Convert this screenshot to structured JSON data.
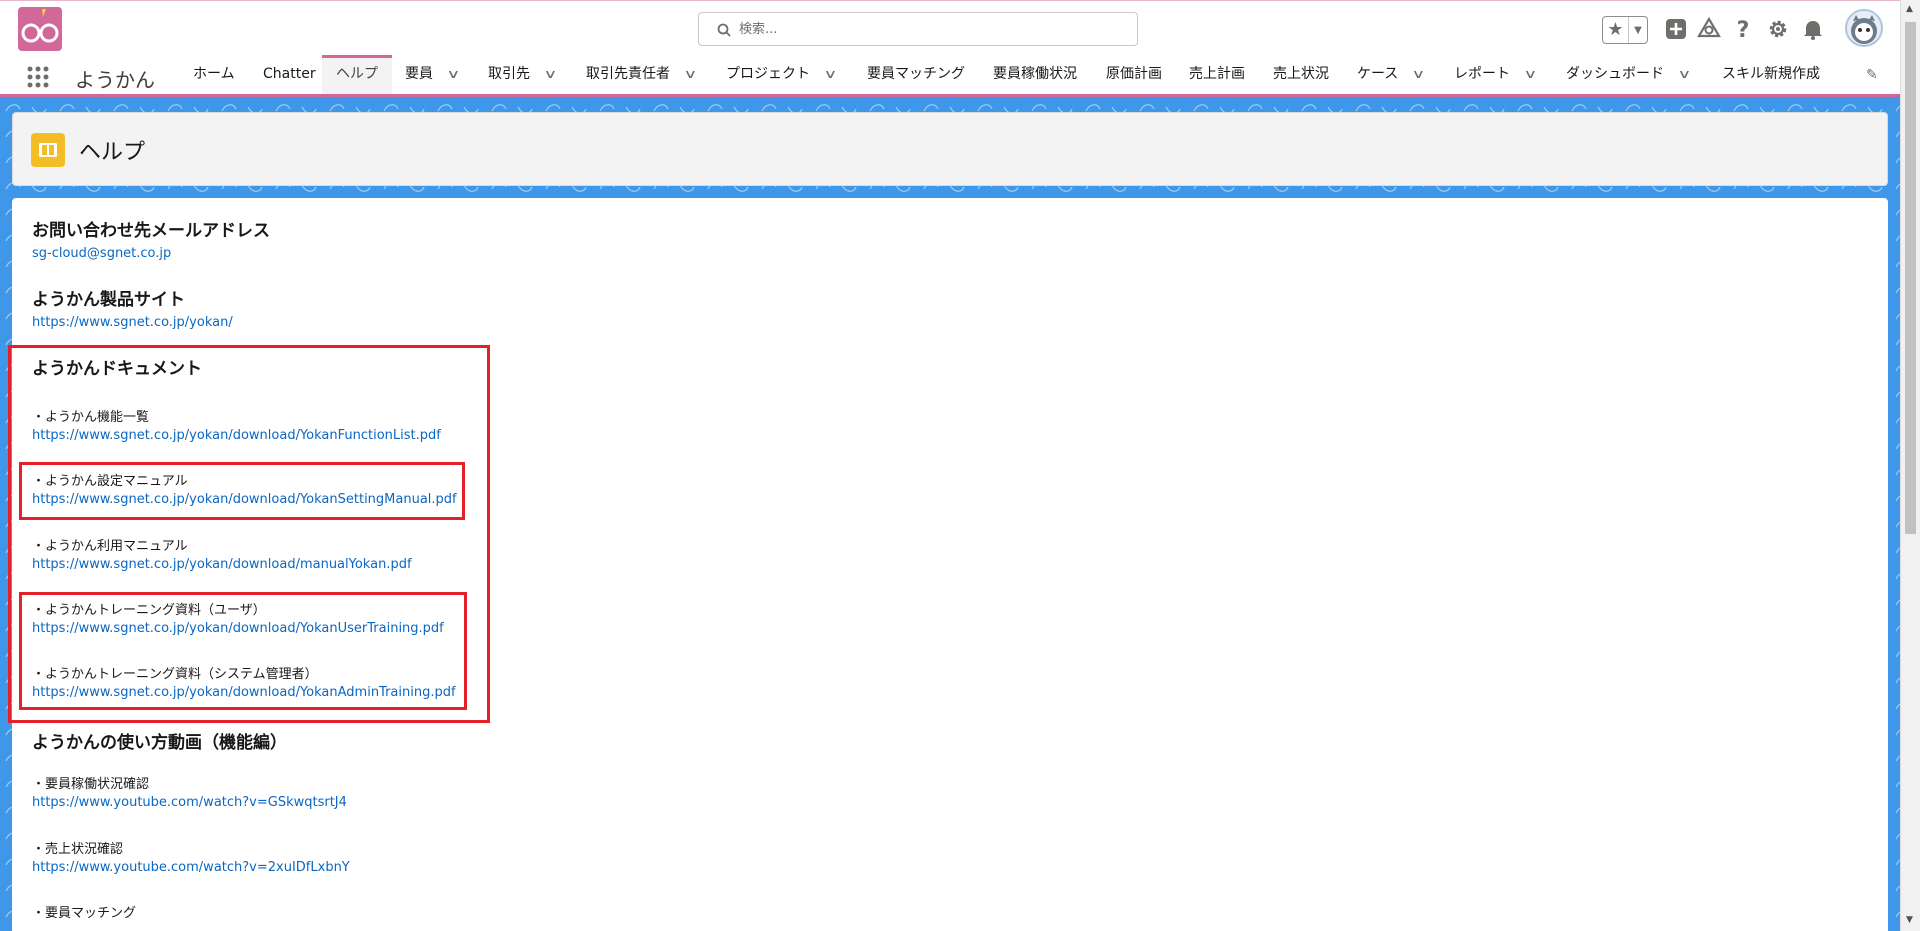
{
  "header": {
    "search_placeholder": "検索...",
    "fav_star": "★",
    "fav_caret": "▼"
  },
  "nav": {
    "app_name": "ようかん",
    "tabs": [
      {
        "label": "ホーム",
        "dropdown": false,
        "active": false
      },
      {
        "label": "Chatter",
        "dropdown": false,
        "active": false
      },
      {
        "label": "ヘルプ",
        "dropdown": false,
        "active": true
      },
      {
        "label": "要員",
        "dropdown": true,
        "active": false
      },
      {
        "label": "取引先",
        "dropdown": true,
        "active": false
      },
      {
        "label": "取引先責任者",
        "dropdown": true,
        "active": false
      },
      {
        "label": "プロジェクト",
        "dropdown": true,
        "active": false
      },
      {
        "label": "要員マッチング",
        "dropdown": false,
        "active": false
      },
      {
        "label": "要員稼働状況",
        "dropdown": false,
        "active": false
      },
      {
        "label": "原価計画",
        "dropdown": false,
        "active": false
      },
      {
        "label": "売上計画",
        "dropdown": false,
        "active": false
      },
      {
        "label": "売上状況",
        "dropdown": false,
        "active": false
      },
      {
        "label": "ケース",
        "dropdown": true,
        "active": false
      },
      {
        "label": "レポート",
        "dropdown": true,
        "active": false
      },
      {
        "label": "ダッシュボード",
        "dropdown": true,
        "active": false
      },
      {
        "label": "スキル新規作成",
        "dropdown": false,
        "active": false
      }
    ],
    "chevron": "∨"
  },
  "page": {
    "title": "ヘルプ"
  },
  "content": {
    "contact": {
      "title": "お問い合わせ先メールアドレス",
      "email": "sg-cloud@sgnet.co.jp"
    },
    "product_site": {
      "title": "ようかん製品サイト",
      "url": "https://www.sgnet.co.jp/yokan/"
    },
    "documents": {
      "title": "ようかんドキュメント",
      "items": [
        {
          "label": "・ようかん機能一覧",
          "url": "https://www.sgnet.co.jp/yokan/download/YokanFunctionList.pdf"
        },
        {
          "label": "・ようかん設定マニュアル",
          "url": "https://www.sgnet.co.jp/yokan/download/YokanSettingManual.pdf"
        },
        {
          "label": "・ようかん利用マニュアル",
          "url": "https://www.sgnet.co.jp/yokan/download/manualYokan.pdf"
        },
        {
          "label": "・ようかんトレーニング資料（ユーザ）",
          "url": "https://www.sgnet.co.jp/yokan/download/YokanUserTraining.pdf"
        },
        {
          "label": "・ようかんトレーニング資料（システム管理者）",
          "url": "https://www.sgnet.co.jp/yokan/download/YokanAdminTraining.pdf"
        }
      ]
    },
    "videos": {
      "title": "ようかんの使い方動画（機能編）",
      "items": [
        {
          "label": "・要員稼働状況確認",
          "url": "https://www.youtube.com/watch?v=GSkwqtsrtJ4"
        },
        {
          "label": "・売上状況確認",
          "url": "https://www.youtube.com/watch?v=2xuIDfLxbnY"
        },
        {
          "label": "・要員マッチング",
          "url": ""
        }
      ]
    }
  },
  "colors": {
    "brand_pink": "#d2679a",
    "link_blue": "#0b67c2",
    "background_blue": "#3e97e8",
    "highlight_red": "#e2212b",
    "help_icon_yellow": "#f4bc25"
  },
  "icons": [
    "app-logo-icon",
    "search-icon",
    "favorites-star-icon",
    "add-icon",
    "trailhead-icon",
    "help-icon",
    "setup-gear-icon",
    "notification-bell-icon",
    "user-avatar",
    "app-launcher-icon",
    "edit-pencil-icon",
    "help-book-icon"
  ]
}
